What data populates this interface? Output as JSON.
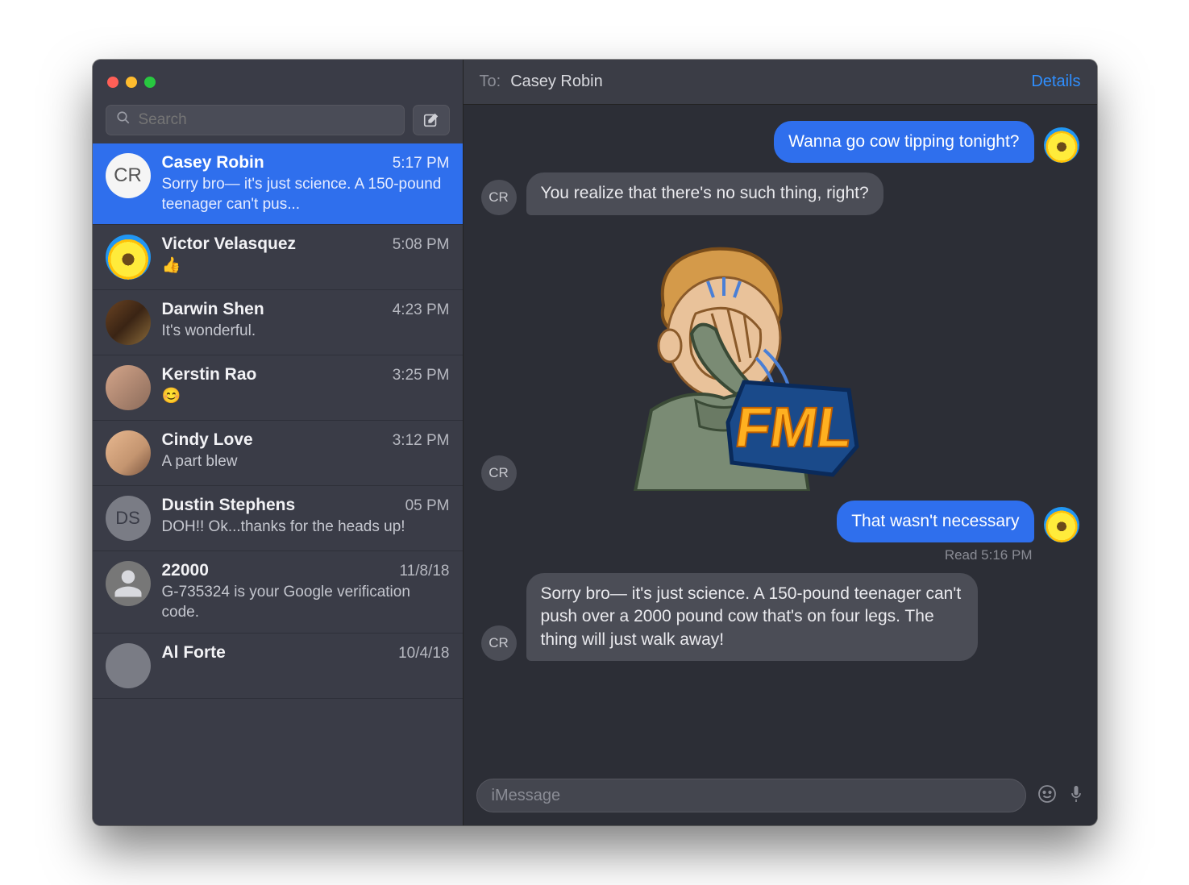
{
  "sidebar": {
    "search_placeholder": "Search",
    "conversations": [
      {
        "name": "Casey Robin",
        "time": "5:17 PM",
        "preview": "Sorry bro— it's just science. A 150-pound teenager can't pus...",
        "avatar_initials": "CR",
        "avatar_type": "white",
        "selected": true
      },
      {
        "name": "Victor Velasquez",
        "time": "5:08 PM",
        "preview": "👍",
        "avatar_type": "sunflower",
        "selected": false
      },
      {
        "name": "Darwin Shen",
        "time": "4:23 PM",
        "preview": "It's wonderful.",
        "avatar_type": "photo1",
        "selected": false
      },
      {
        "name": "Kerstin Rao",
        "time": "3:25 PM",
        "preview": "😊",
        "avatar_type": "photo2",
        "selected": false
      },
      {
        "name": "Cindy Love",
        "time": "3:12 PM",
        "preview": "A part blew",
        "avatar_type": "photo3",
        "selected": false
      },
      {
        "name": "Dustin Stephens",
        "time": "05 PM",
        "preview": "DOH!! Ok...thanks for the heads up!",
        "avatar_initials": "DS",
        "avatar_type": "gray",
        "selected": false
      },
      {
        "name": "22000",
        "time": "11/8/18",
        "preview": "G-735324 is your Google verification code.",
        "avatar_type": "silhouette",
        "selected": false
      },
      {
        "name": "Al Forte",
        "time": "10/4/18",
        "preview": "",
        "avatar_type": "gray",
        "selected": false
      }
    ]
  },
  "header": {
    "to_label": "To:",
    "recipient": "Casey Robin",
    "details_label": "Details"
  },
  "messages": [
    {
      "direction": "out",
      "text": "Wanna go cow tipping tonight?",
      "avatar": "sunflower"
    },
    {
      "direction": "in",
      "text": "You realize that there's no such thing, right?",
      "avatar_initials": "CR"
    },
    {
      "direction": "in",
      "type": "sticker",
      "sticker_label": "FML",
      "avatar_initials": "CR"
    },
    {
      "direction": "out",
      "text": "That wasn't necessary",
      "avatar": "sunflower",
      "status": "Read 5:16 PM"
    },
    {
      "direction": "in",
      "text": "Sorry bro— it's just science. A 150-pound teenager can't push over a 2000 pound cow that's on four legs. The thing will just walk away!",
      "avatar_initials": "CR"
    }
  ],
  "input": {
    "placeholder": "iMessage"
  }
}
